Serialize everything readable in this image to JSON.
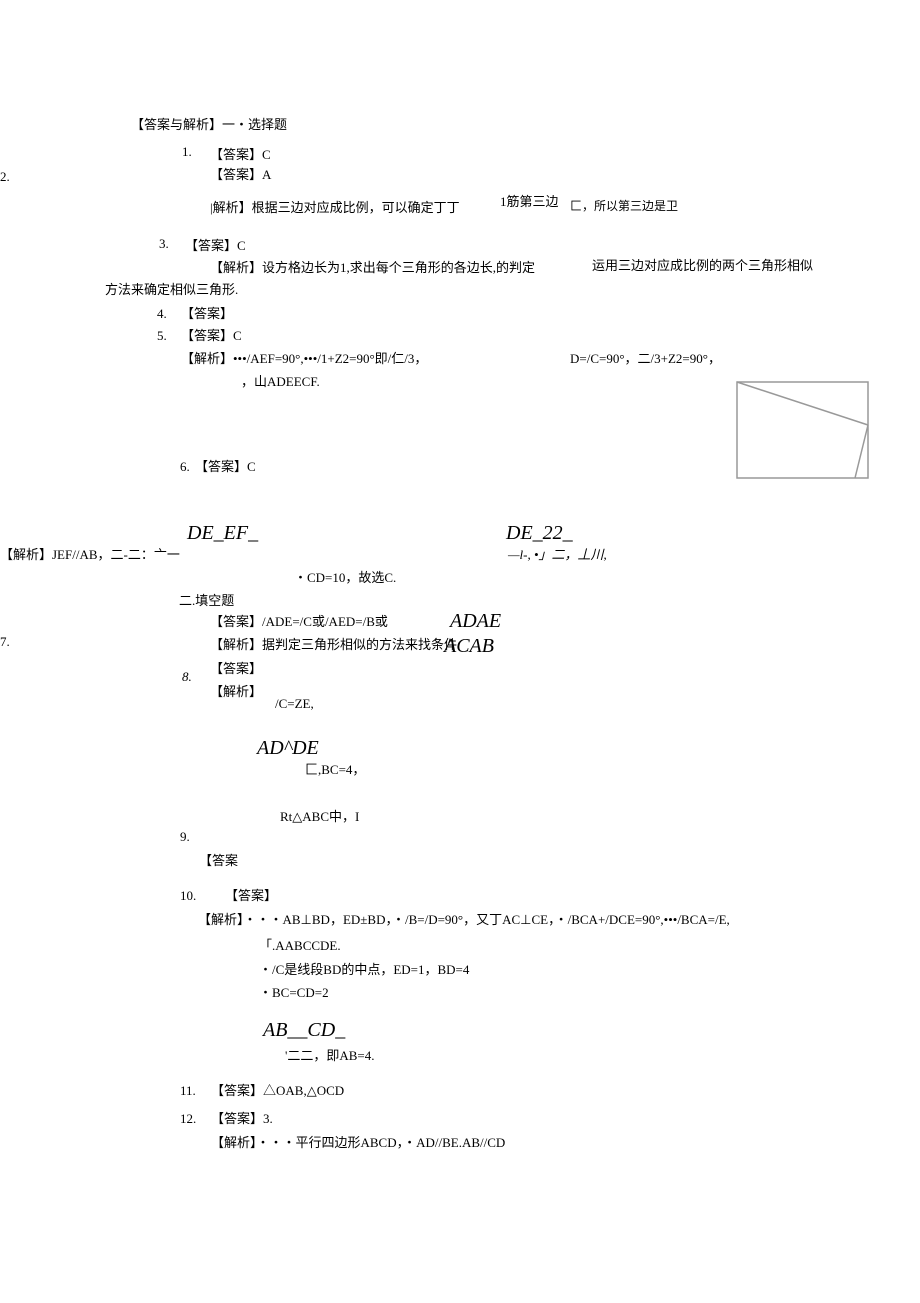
{
  "header": {
    "title": "【答案与解析】一・选择题"
  },
  "items": {
    "q1": {
      "num": "1.",
      "answer": "【答案】C"
    },
    "q2": {
      "num": "2.",
      "answer": "【答案】A",
      "analysis_label": "|解析】根据三边对应成比例，可以确定丁丁",
      "extra": "1筋第三边",
      "extra2": "匚，所以第三边是卫"
    },
    "q3": {
      "num": "3.",
      "answer": "【答案】C",
      "analysis": "【解析】设方格边长为1,求出每个三角形的各边长,的判定",
      "analysis2": "运用三边对应成比例的两个三角形相似",
      "analysis3": "方法来确定相似三角形."
    },
    "q4": {
      "num": "4.",
      "answer": "【答案】"
    },
    "q5": {
      "num": "5.",
      "answer": "【答案】C",
      "analysis1": "【解析】•••/AEF=90°,•••/1+Z2=90°即/仁/3，",
      "analysis1b": "D=/C=90°，二/3+Z2=90°，",
      "analysis2": "，山ADEECF."
    },
    "q6": {
      "num": "6.",
      "answer": "【答案】C",
      "formula1": "DE_EF_",
      "formula2": "DE_22_",
      "analysis": "【解析】JEF//AB，二-二：亠一",
      "formula3": "—l-, •」二，丄川,",
      "result": "・CD=10，故选C."
    },
    "section2": "二.填空题",
    "q7": {
      "num": "7.",
      "answer": "【答案】/ADE=/C或/AED=/B或",
      "formula": "ADAE",
      "analysis": "【解析】据判定三角形相似的方法来找条件",
      "formula2": "ACAB"
    },
    "q8": {
      "num": "8.",
      "answer": "【答案】",
      "analysis_label": "【解析】",
      "line1": "/C=ZE,",
      "formula": "AD^DE",
      "line2": "匚,BC=4，",
      "line3": "Rt△ABC中，I"
    },
    "q9": {
      "num": "9.",
      "answer": "【答案"
    },
    "q10": {
      "num": "10.",
      "answer": "【答案】",
      "analysis1": "【解析】・・・AB⊥BD，ED±BD，・/B=/D=90°，又丁AC⊥CE，・/BCA+/DCE=90°,•••/BCA=/E,",
      "line2": "「.AABCCDE.",
      "line3": "・/C是线段BD的中点，ED=1，BD=4",
      "line4": "・BC=CD=2",
      "formula": "AB__CD_",
      "line5": "'二二，即AB=4."
    },
    "q11": {
      "num": "11.",
      "answer": "【答案】△OAB,△OCD"
    },
    "q12": {
      "num": "12.",
      "answer": "【答案】3.",
      "analysis": "【解析】・・・平行四边形ABCD，・AD//BE.AB//CD"
    }
  }
}
